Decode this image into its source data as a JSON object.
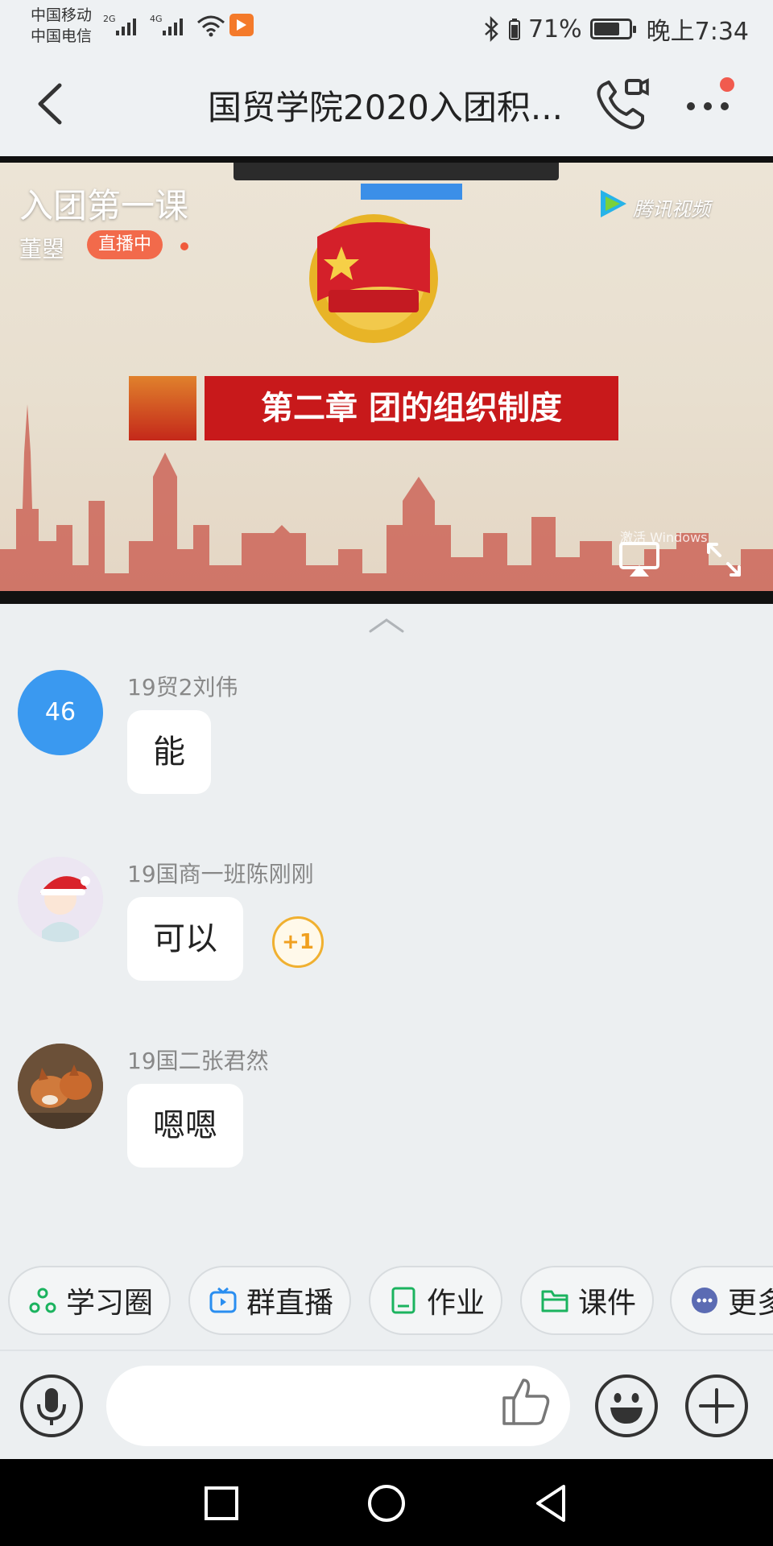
{
  "status_bar": {
    "carrier_1": "中国移动",
    "carrier_2": "中国电信",
    "network_1": "2G",
    "network_2": "4G",
    "battery_text": "71%",
    "battery_level": 0.71,
    "time": "晚上7:34",
    "icons": [
      "signal-icon",
      "wifi-icon",
      "app-notification-icon",
      "bluetooth-icon",
      "battery-icon"
    ]
  },
  "header": {
    "title": "国贸学院2020入团积...",
    "icons": [
      "back-arrow-icon",
      "video-call-icon",
      "more-dots-icon"
    ],
    "notification_color": "#f15b4e"
  },
  "live": {
    "course_title": "入团第一课",
    "host_name": "董曌",
    "live_badge": "直播中",
    "platform_logo": "腾讯视频",
    "slide_heading": "第二章 团的组织制度",
    "watermark": "激活 Windows",
    "accent_color": "#f26a4b"
  },
  "messages": [
    {
      "sender": "19贸2刘伟",
      "avatar_text": "46",
      "text": "能"
    },
    {
      "sender": "19国商一班陈刚刚",
      "text": "可以",
      "reaction": "+1"
    },
    {
      "sender": "19国二张君然",
      "text": "嗯嗯"
    }
  ],
  "quick_actions": [
    {
      "label": "学习圈",
      "icon": "circle-nodes-icon",
      "color": "#1bb35f"
    },
    {
      "label": "群直播",
      "icon": "tv-live-icon",
      "color": "#2a8ef0"
    },
    {
      "label": "作业",
      "icon": "notebook-icon",
      "color": "#1bb35f"
    },
    {
      "label": "课件",
      "icon": "folder-icon",
      "color": "#1bb35f"
    },
    {
      "label": "更多",
      "icon": "more-circle-icon",
      "color": "#5b6bb3"
    }
  ],
  "input_bar": {
    "icons": [
      "microphone-icon",
      "thumbs-up-icon",
      "emoji-icon",
      "plus-circle-icon"
    ]
  },
  "nav_bar": {
    "icons": [
      "recent-apps-icon",
      "home-icon",
      "back-triangle-icon"
    ]
  }
}
